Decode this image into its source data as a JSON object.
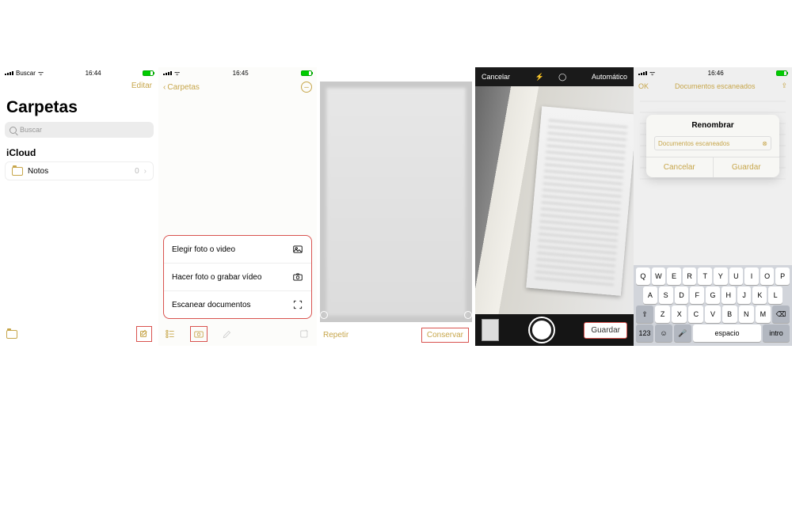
{
  "status": {
    "back_label": "Buscar",
    "time1": "16:44",
    "time2": "16:45",
    "time5": "16:46"
  },
  "panel1": {
    "edit": "Editar",
    "title": "Carpetas",
    "search_placeholder": "Buscar",
    "section": "iCloud",
    "folder": {
      "name": "Notos",
      "count": "0"
    }
  },
  "panel2": {
    "back": "Carpetas",
    "menu": {
      "choose": "Elegir foto o video",
      "capture": "Hacer foto o grabar vídeo",
      "scan": "Escanear documentos"
    }
  },
  "panel3": {
    "retake": "Repetir",
    "keep": "Conservar"
  },
  "panel4": {
    "cancel": "Cancelar",
    "auto": "Automático",
    "save": "Guardar"
  },
  "panel5": {
    "ok": "OK",
    "header": "Documentos escaneados",
    "rename_title": "Renombrar",
    "rename_value": "Documentos escaneados",
    "cancel": "Cancelar",
    "save": "Guardar",
    "kbd": {
      "r1": [
        "Q",
        "W",
        "E",
        "R",
        "T",
        "Y",
        "U",
        "I",
        "O",
        "P"
      ],
      "r2": [
        "A",
        "S",
        "D",
        "F",
        "G",
        "H",
        "J",
        "K",
        "L"
      ],
      "r3": [
        "Z",
        "X",
        "C",
        "V",
        "B",
        "N",
        "M"
      ],
      "num": "123",
      "space": "espacio",
      "enter": "intro"
    }
  }
}
